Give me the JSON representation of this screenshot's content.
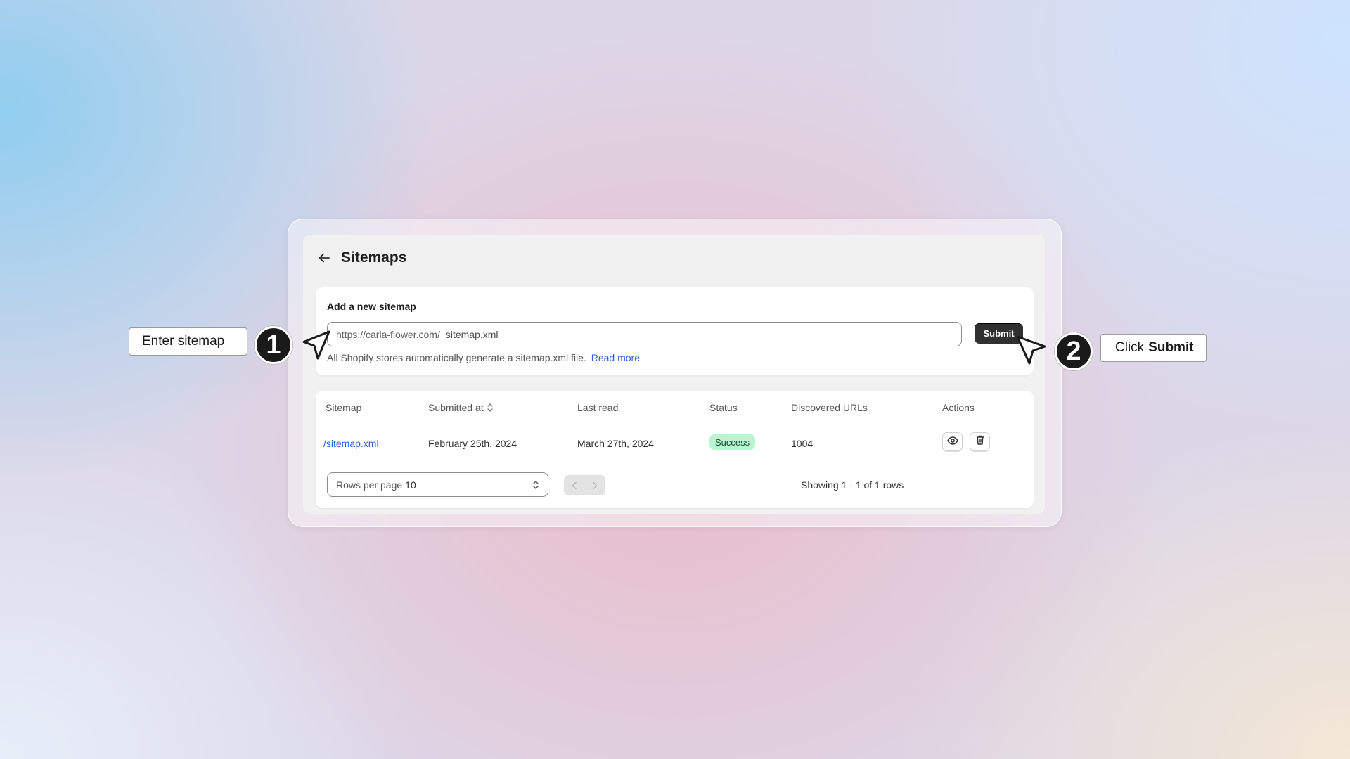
{
  "header": {
    "title": "Sitemaps",
    "back_icon": "arrow-left-icon"
  },
  "add_sitemap": {
    "title": "Add a new sitemap",
    "url_prefix": "https://carla-flower.com/",
    "input_value": "sitemap.xml",
    "submit_label": "Submit",
    "help_text": "All Shopify stores automatically generate a sitemap.xml file.",
    "help_link": "Read more"
  },
  "table": {
    "columns": [
      "Sitemap",
      "Submitted at",
      "Last read",
      "Status",
      "Discovered URLs",
      "Actions"
    ],
    "rows": [
      {
        "sitemap": "/sitemap.xml",
        "submitted_at": "February 25th, 2024",
        "last_read": "March 27th, 2024",
        "status": "Success",
        "discovered_urls": "1004",
        "actions": [
          "eye-icon",
          "trash-icon"
        ]
      }
    ]
  },
  "pagination": {
    "rows_label": "Rows per page",
    "rows_value": "10",
    "showing": "Showing 1 - 1 of 1 rows"
  },
  "callouts": {
    "step1_number": "1",
    "step1_text": "Enter sitemap",
    "step2_number": "2",
    "step2_text_prefix": "Click",
    "step2_text_bold": "Submit"
  },
  "colors": {
    "link": "#2b5fd9",
    "primary_button": "#303030",
    "success_badge_bg": "#b9f5cf",
    "success_badge_text": "#0c5132"
  }
}
